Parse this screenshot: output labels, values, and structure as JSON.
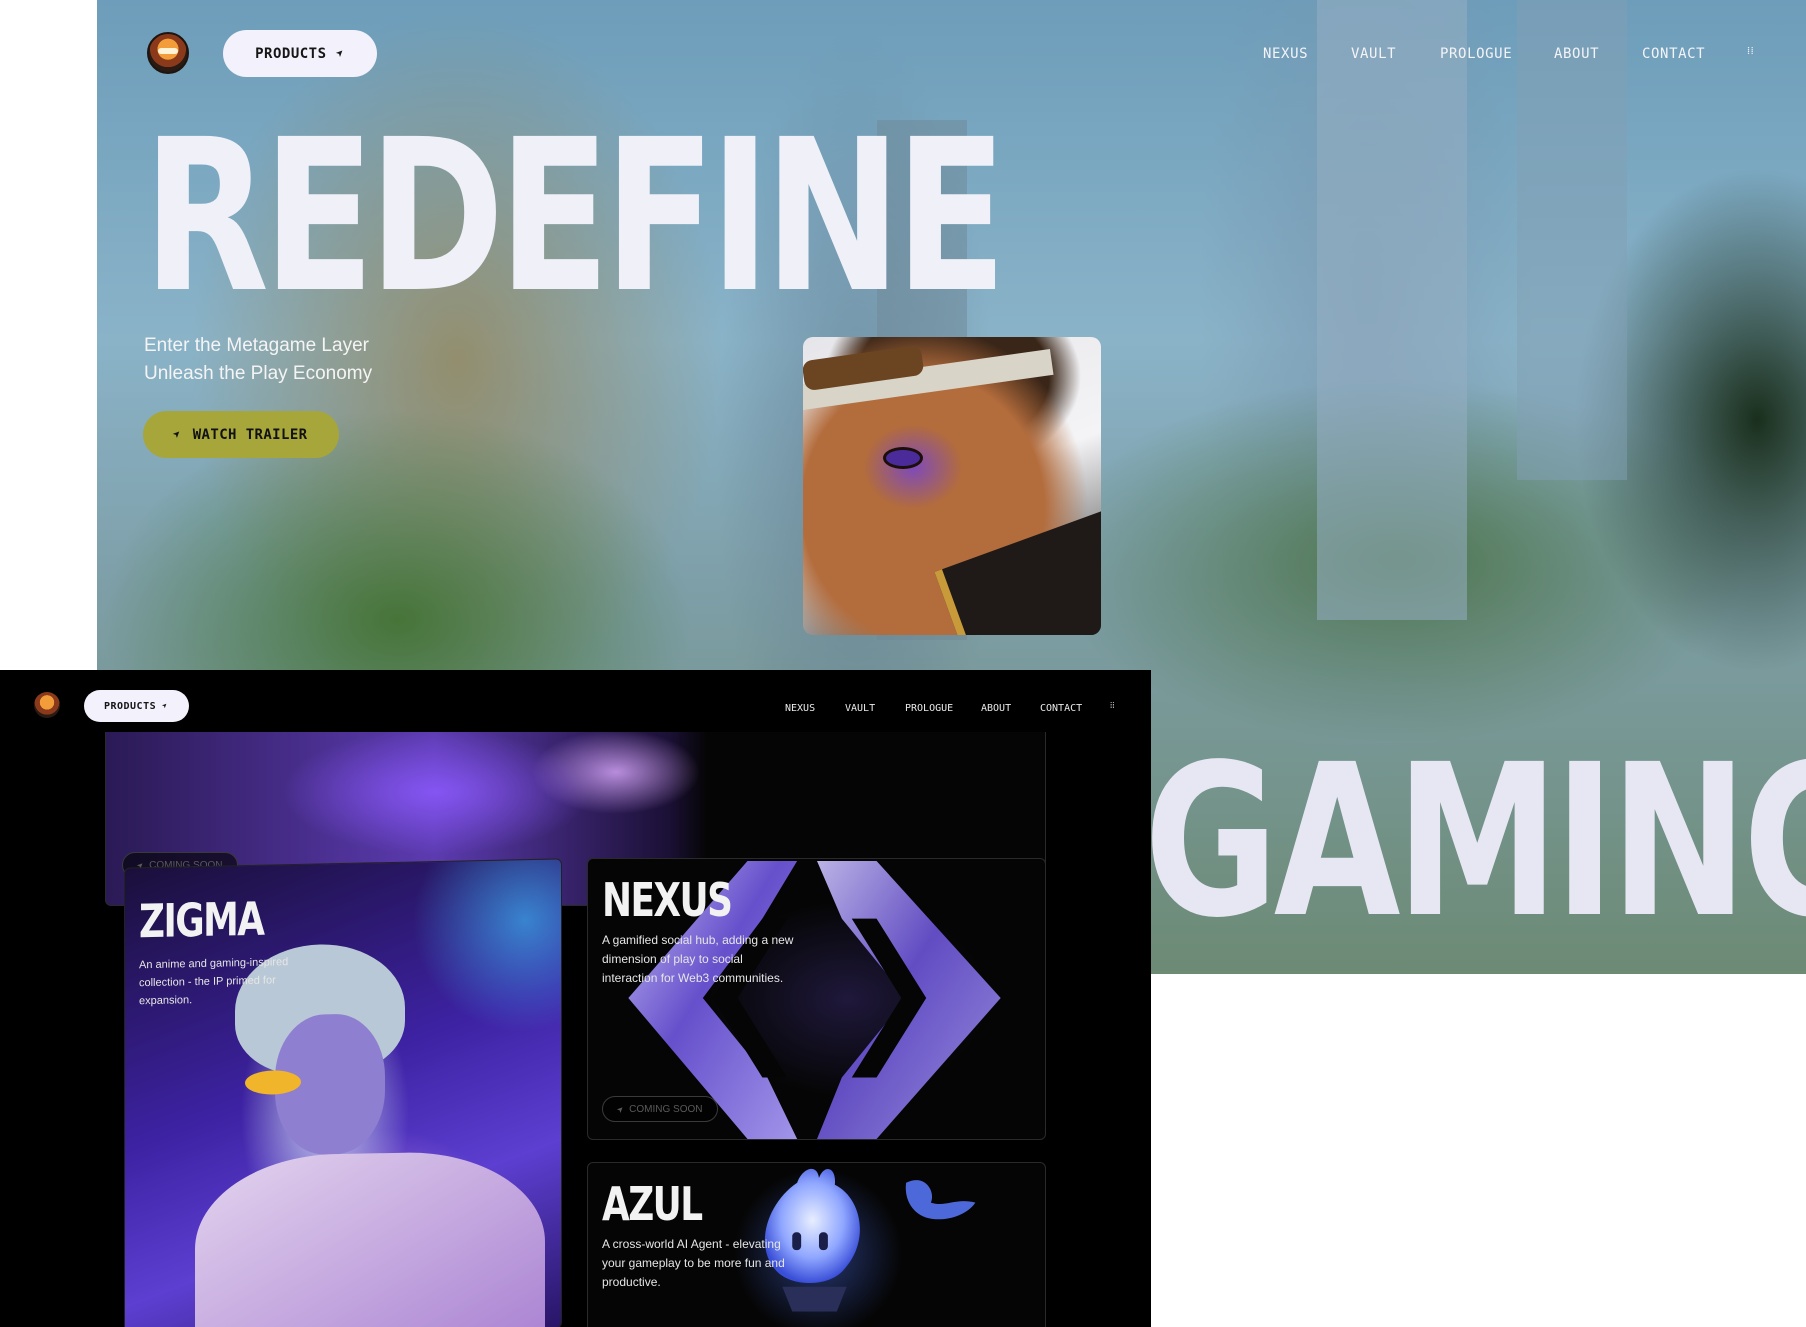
{
  "hero": {
    "products_label": "PRODUCTS",
    "nav": [
      "NEXUS",
      "VAULT",
      "PROLOGUE",
      "ABOUT",
      "CONTACT"
    ],
    "menu_glyph": "⁞⁞",
    "title": "REDEFINE",
    "subtitle_line1": "Enter the Metagame Layer",
    "subtitle_line2": "Unleash the Play Economy",
    "trailer_label": "WATCH TRAILER",
    "title2": "GAMING",
    "accent_color": "#a6a63a"
  },
  "front": {
    "products_label": "PRODUCTS",
    "nav": [
      "NEXUS",
      "VAULT",
      "PROLOGUE",
      "ABOUT",
      "CONTACT"
    ],
    "menu_glyph": "⁞⁞",
    "banner_badge": "COMING SOON",
    "cards": {
      "zigma": {
        "title": "ZIGMA",
        "desc_line1": "An anime and gaming-inspired",
        "desc_line2": "collection - the IP primed for",
        "desc_line3": "expansion."
      },
      "nexus": {
        "title": "NEXUS",
        "desc_line1": "A gamified social hub, adding a new",
        "desc_line2": "dimension of play to social",
        "desc_line3": "interaction for Web3 communities.",
        "badge": "COMING SOON"
      },
      "azul": {
        "title": "AZUL",
        "desc_line1": "A cross-world AI Agent - elevating",
        "desc_line2": "your gameplay to be more fun and",
        "desc_line3": "productive."
      }
    }
  }
}
